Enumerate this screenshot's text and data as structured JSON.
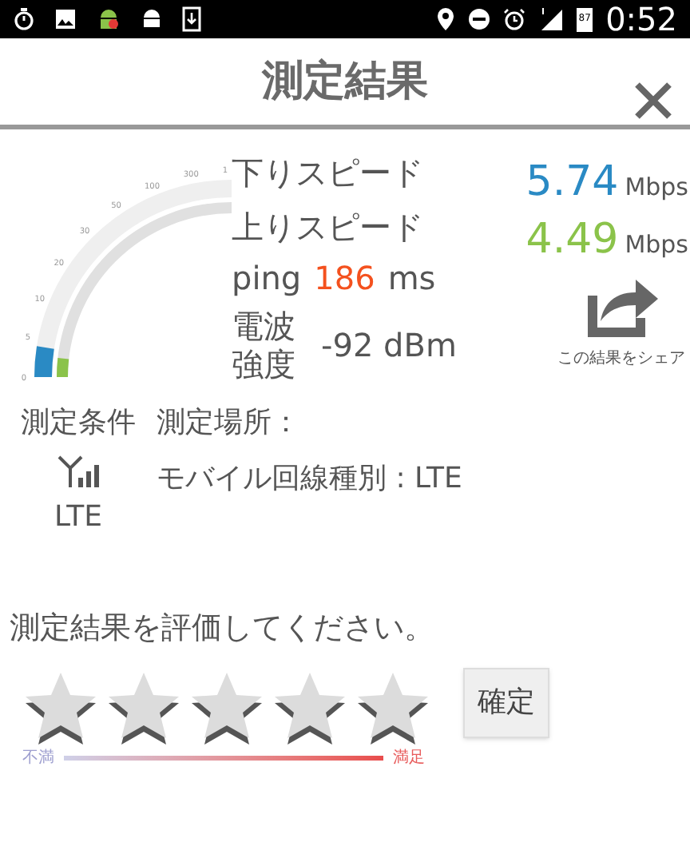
{
  "status_bar": {
    "battery": "87",
    "time": "0:52"
  },
  "title": "測定結果",
  "gauge": {
    "ticks": [
      "0",
      "5",
      "10",
      "20",
      "30",
      "50",
      "100",
      "300",
      "1"
    ]
  },
  "results": {
    "download_label": "下りスピード",
    "download_value": "5.74",
    "download_unit": "Mbps",
    "upload_label": "上りスピード",
    "upload_value": "4.49",
    "upload_unit": "Mbps",
    "ping_label": "ping",
    "ping_value": "186",
    "ping_unit": "ms",
    "signal_label": "電波強度",
    "signal_value": "-92 dBm"
  },
  "share_label": "この結果をシェア",
  "conditions": {
    "label": "測定条件",
    "network": "LTE",
    "location": "測定場所：",
    "line_type": "モバイル回線種別 : LTE"
  },
  "rating": {
    "prompt": "測定結果を評価してください。",
    "stars": 0,
    "low_label": "不満",
    "high_label": "満足",
    "confirm": "確定"
  }
}
